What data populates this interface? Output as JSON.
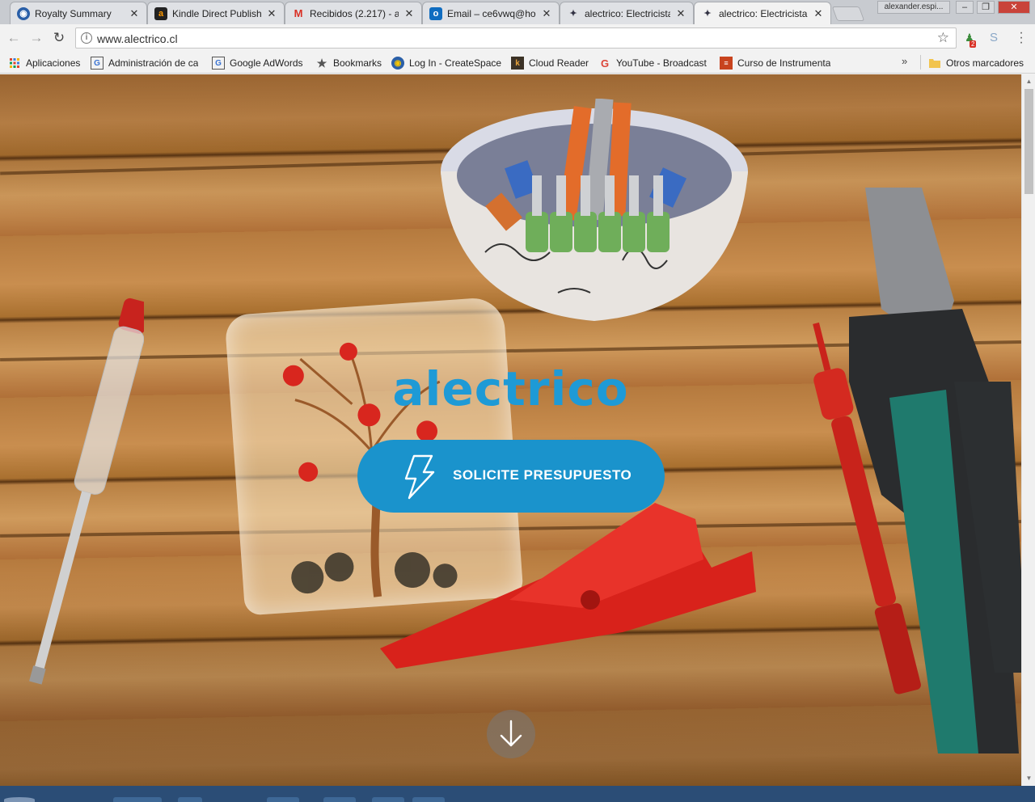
{
  "browser": {
    "tabs": [
      {
        "title": "Royalty Summary",
        "icon": "createspace-icon",
        "active": false
      },
      {
        "title": "Kindle Direct Publish",
        "icon": "amazon-icon",
        "active": false
      },
      {
        "title": "Recibidos (2.217) - a",
        "icon": "gmail-icon",
        "active": false
      },
      {
        "title": "Email – ce6vwq@ho",
        "icon": "outlook-icon",
        "active": false
      },
      {
        "title": "alectrico: Electricista",
        "icon": "alectrico-icon",
        "active": false
      },
      {
        "title": "alectrico: Electricista",
        "icon": "alectrico-icon",
        "active": true
      }
    ],
    "profile_name": "alexander.espi...",
    "url": "www.alectrico.cl",
    "extension_badge": "2"
  },
  "bookmarks": [
    {
      "label": "Aplicaciones",
      "icon": "apps-grid-icon"
    },
    {
      "label": "Administración de ca",
      "icon": "google-g-icon"
    },
    {
      "label": "Google AdWords",
      "icon": "google-g-icon"
    },
    {
      "label": "Bookmarks",
      "icon": "star-icon"
    },
    {
      "label": "Log In - CreateSpace",
      "icon": "createspace-icon"
    },
    {
      "label": "Cloud Reader",
      "icon": "kindle-k-icon"
    },
    {
      "label": "YouTube - Broadcast",
      "icon": "google-g-icon"
    },
    {
      "label": "Curso de Instrumenta",
      "icon": "course-icon"
    }
  ],
  "other_bookmarks": "Otros marcadores",
  "hero": {
    "brand": "alectrico",
    "cta_label": "SOLICITE PRESUPUESTO"
  },
  "colors": {
    "brand_blue": "#1e9ad6",
    "cta_blue": "#1a93cc"
  }
}
